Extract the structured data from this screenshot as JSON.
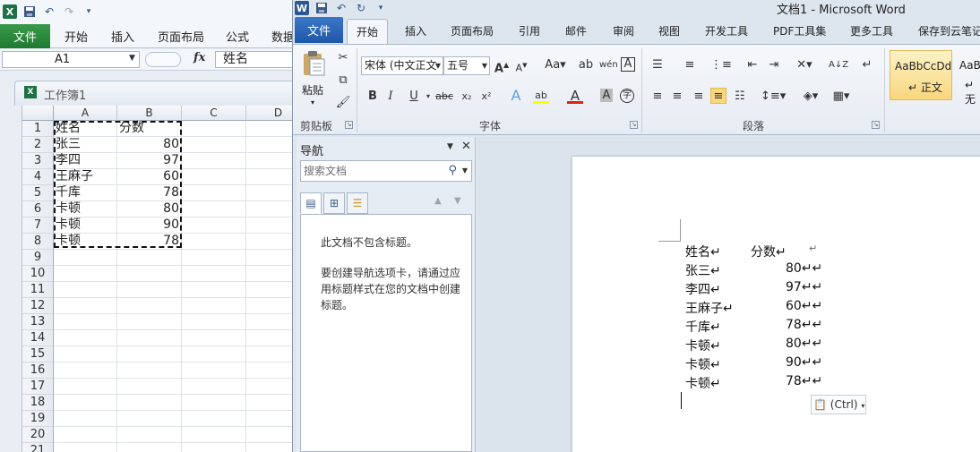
{
  "excel": {
    "tabs": [
      "文件",
      "开始",
      "插入",
      "页面布局",
      "公式",
      "数据"
    ],
    "name_box": "A1",
    "formula_fx": "fx",
    "formula_value": "姓名",
    "workbook_title": "工作簿1",
    "columns": [
      "A",
      "B",
      "C",
      "D"
    ],
    "rows": [
      "1",
      "2",
      "3",
      "4",
      "5",
      "6",
      "7",
      "8",
      "9",
      "10",
      "11",
      "12",
      "13",
      "14",
      "15",
      "16",
      "17",
      "18",
      "19",
      "20",
      "21"
    ],
    "table": [
      {
        "name": "姓名",
        "score": "分数"
      },
      {
        "name": "张三",
        "score": "80"
      },
      {
        "name": "李四",
        "score": "97"
      },
      {
        "name": "王麻子",
        "score": "60"
      },
      {
        "name": "千库",
        "score": "78"
      },
      {
        "name": "卡顿",
        "score": "80"
      },
      {
        "name": "卡顿",
        "score": "90"
      },
      {
        "name": "卡顿",
        "score": "78"
      }
    ]
  },
  "word": {
    "window_title": "文档1 - Microsoft Word",
    "tabs": [
      "文件",
      "开始",
      "插入",
      "页面布局",
      "引用",
      "邮件",
      "审阅",
      "视图",
      "开发工具",
      "PDF工具集",
      "更多工具",
      "保存到云笔记"
    ],
    "ribbon": {
      "paste_label": "粘贴",
      "clipboard_label": "剪贴板",
      "font_name": "宋体 (中文正文",
      "font_size": "五号",
      "font_label": "字体",
      "paragraph_label": "段落",
      "style_sample": "AaBbCcDd",
      "style_name": "↵ 正文",
      "style_sample_2": "AaBb",
      "style_name_2": "↵ 无"
    },
    "nav": {
      "title": "导航",
      "search_placeholder": "搜索文档",
      "msg1": "此文档不包含标题。",
      "msg2": "要创建导航选项卡，请通过应用标题样式在您的文档中创建标题。"
    },
    "doc_lines": [
      {
        "name": "姓名↵",
        "score": "分数↵",
        "end": "↵"
      },
      {
        "name": "张三↵",
        "score": "80↵↵"
      },
      {
        "name": "李四↵",
        "score": "97↵↵"
      },
      {
        "name": "王麻子↵",
        "score": "60↵↵"
      },
      {
        "name": "千库↵",
        "score": "78↵↵"
      },
      {
        "name": "卡顿↵",
        "score": "80↵↵"
      },
      {
        "name": "卡顿↵",
        "score": "90↵↵"
      },
      {
        "name": "卡顿↵",
        "score": "78↵↵"
      }
    ],
    "paste_options": "(Ctrl)"
  }
}
